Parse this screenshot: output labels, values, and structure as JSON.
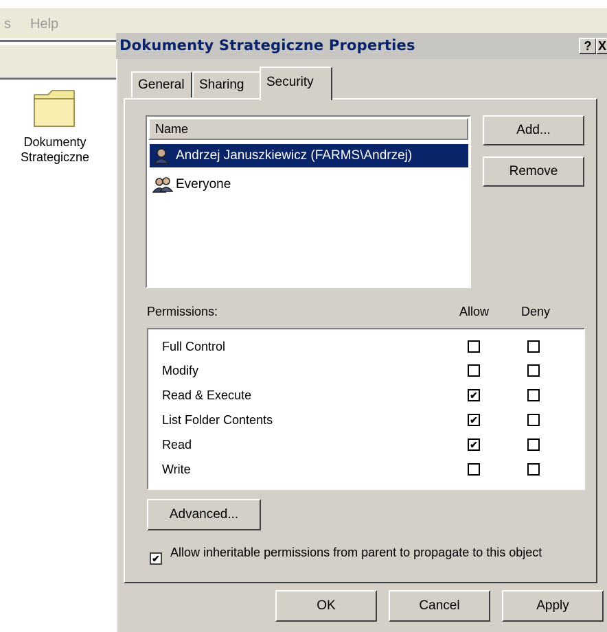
{
  "background_window": {
    "menu": [
      "s",
      "Help"
    ],
    "folder_label": "Dokumenty Strategiczne"
  },
  "dialog": {
    "title": "Dokumenty Strategiczne Properties",
    "help_button": "?",
    "close_button": "X",
    "tabs": [
      {
        "label": "General",
        "active": false
      },
      {
        "label": "Sharing",
        "active": false
      },
      {
        "label": "Security",
        "active": true
      }
    ],
    "names_list": {
      "header": "Name",
      "items": [
        {
          "label": "Andrzej Januszkiewicz (FARMS\\Andrzej)",
          "selected": true,
          "icon": "user-icon"
        },
        {
          "label": "Everyone",
          "selected": false,
          "icon": "group-icon"
        }
      ]
    },
    "add_button": "Add...",
    "remove_button": "Remove",
    "permissions": {
      "label": "Permissions:",
      "allow_header": "Allow",
      "deny_header": "Deny",
      "rows": [
        {
          "label": "Full Control",
          "allow": false,
          "deny": false
        },
        {
          "label": "Modify",
          "allow": false,
          "deny": false
        },
        {
          "label": "Read & Execute",
          "allow": true,
          "deny": false
        },
        {
          "label": "List Folder Contents",
          "allow": true,
          "deny": false
        },
        {
          "label": "Read",
          "allow": true,
          "deny": false
        },
        {
          "label": "Write",
          "allow": false,
          "deny": false
        }
      ]
    },
    "advanced_button": "Advanced...",
    "inherit_checkbox": {
      "checked": true,
      "label": "Allow inheritable permissions from parent to propagate to this object"
    },
    "ok_button": "OK",
    "cancel_button": "Cancel",
    "apply_button": "Apply"
  },
  "colors": {
    "dialog_face": "#d4d0c8",
    "selection": "#0a246a",
    "title_text": "#0a246a"
  }
}
